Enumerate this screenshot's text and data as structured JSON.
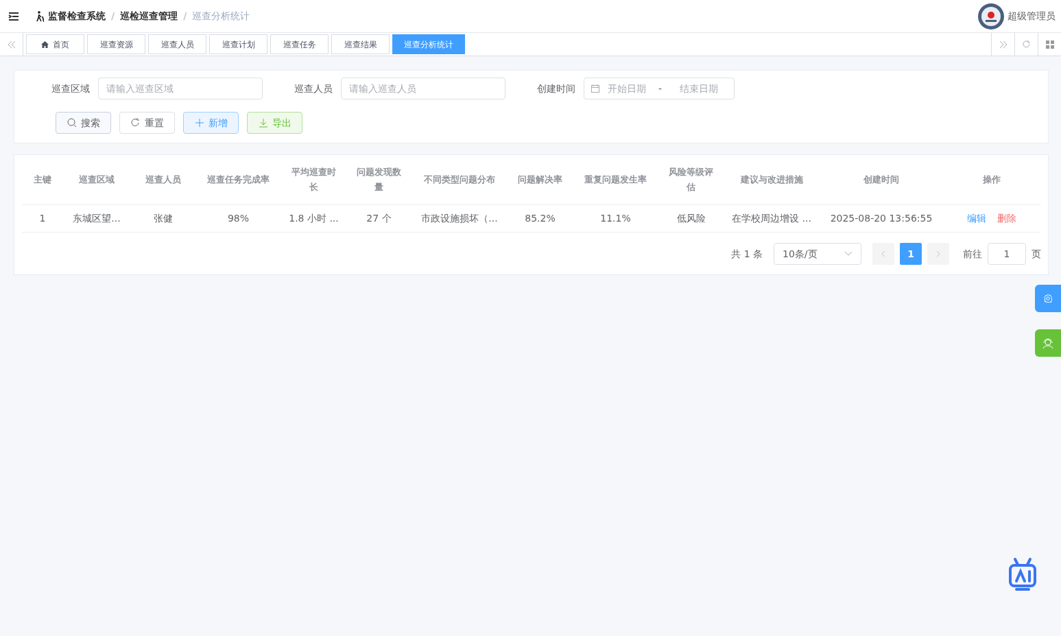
{
  "breadcrumb_separator": "/",
  "breadcrumb": [
    {
      "label": "监督检查系统",
      "current": false
    },
    {
      "label": "巡检巡查管理",
      "current": false
    },
    {
      "label": "巡查分析统计",
      "current": true
    }
  ],
  "user": {
    "name": "超级管理员"
  },
  "tabs": [
    {
      "label": "首页",
      "kind": "home",
      "selected": false
    },
    {
      "label": "巡查资源",
      "kind": "page",
      "selected": false
    },
    {
      "label": "巡查人员",
      "kind": "page",
      "selected": false
    },
    {
      "label": "巡查计划",
      "kind": "page",
      "selected": false
    },
    {
      "label": "巡查任务",
      "kind": "page",
      "selected": false
    },
    {
      "label": "巡查结果",
      "kind": "page",
      "selected": false
    },
    {
      "label": "巡查分析统计",
      "kind": "page",
      "selected": true
    }
  ],
  "filters": [
    {
      "kind": "text",
      "label": "巡查区域",
      "placeholder": "请输入巡查区域"
    },
    {
      "kind": "text",
      "label": "巡查人员",
      "placeholder": "请输入巡查人员"
    },
    {
      "kind": "daterange",
      "label": "创建时间",
      "start_placeholder": "开始日期",
      "separator": "-",
      "end_placeholder": "结束日期"
    }
  ],
  "buttons": [
    {
      "kind": "search",
      "label": "搜索"
    },
    {
      "kind": "reset",
      "label": "重置"
    },
    {
      "kind": "add",
      "label": "新增"
    },
    {
      "kind": "export",
      "label": "导出"
    }
  ],
  "table": {
    "columns": [
      "主键",
      "巡查区域",
      "巡查人员",
      "巡查任务完成率",
      "平均巡查时长",
      "问题发现数量",
      "不同类型问题分布",
      "问题解决率",
      "重复问题发生率",
      "风险等级评估",
      "建议与改进措施",
      "创建时间",
      "操作"
    ],
    "rows": [
      {
        "cells": [
          "1",
          "东城区望...",
          "张健",
          "98%",
          "1.8 小时 ...",
          "27 个",
          "市政设施损坏（...",
          "85.2%",
          "11.1%",
          "低风险",
          "在学校周边增设 ...",
          "2025-08-20 13:56:55"
        ],
        "actions": [
          {
            "kind": "edit",
            "label": "编辑"
          },
          {
            "kind": "delete",
            "label": "删除"
          }
        ]
      }
    ]
  },
  "pagination": {
    "total": "共 1 条",
    "page_size": "10条/页",
    "pages": [
      {
        "label": "1",
        "selected": true
      }
    ],
    "goto_label": "前往",
    "goto_value": "1",
    "goto_suffix": "页"
  }
}
